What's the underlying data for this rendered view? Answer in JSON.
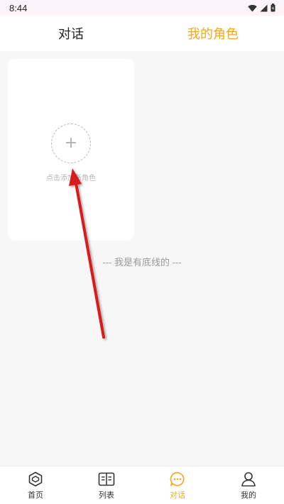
{
  "status_bar": {
    "time": "8:44",
    "icons": [
      "wifi-icon",
      "signal-icon",
      "battery-icon"
    ]
  },
  "top_tabs": [
    {
      "label": "对话",
      "active": false
    },
    {
      "label": "我的角色",
      "active": true
    }
  ],
  "add_card": {
    "icon": "plus-icon",
    "plus_symbol": "+",
    "label": "点击添加新角色"
  },
  "footer_text": "--- 我是有底线的 ---",
  "annotation": {
    "type": "arrow",
    "color": "#d81e1e"
  },
  "bottom_nav": [
    {
      "label": "首页",
      "icon": "home-cube-icon",
      "active": false
    },
    {
      "label": "列表",
      "icon": "book-list-icon",
      "active": false
    },
    {
      "label": "对话",
      "icon": "chat-bubble-icon",
      "active": true
    },
    {
      "label": "我的",
      "icon": "user-profile-icon",
      "active": false
    }
  ],
  "colors": {
    "accent": "#f5a623",
    "background": "#f7f7f7",
    "card": "#ffffff",
    "text_primary": "#222222",
    "text_muted": "#999999"
  }
}
